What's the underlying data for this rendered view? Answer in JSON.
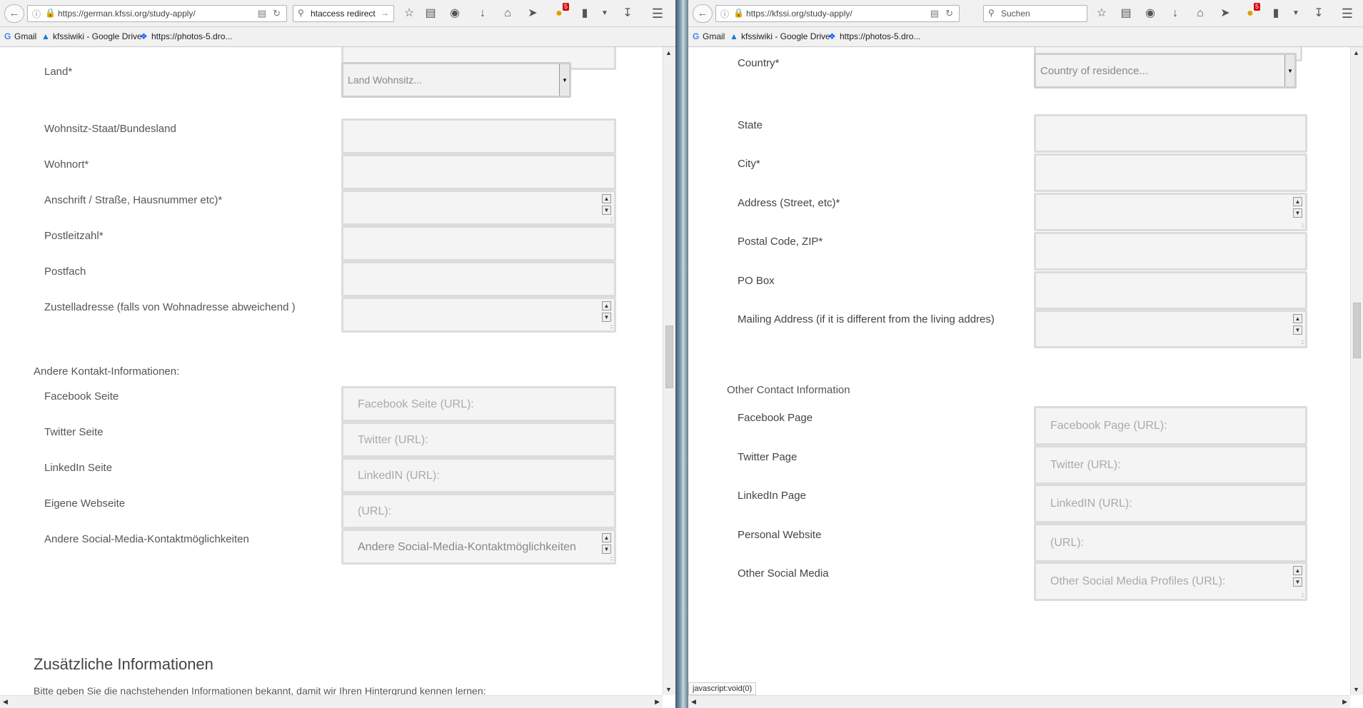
{
  "left": {
    "browser": {
      "url": "https://german.kfssi.org/study-apply/",
      "search_value": "htaccess redirect",
      "badge_count": "5",
      "bookmarks": [
        {
          "icon": "google-icon",
          "label": "Gmail"
        },
        {
          "icon": "drive-icon",
          "label": "kfssiwiki - Google Drive"
        },
        {
          "icon": "dropbox-icon",
          "label": "https://photos-5.dro..."
        }
      ]
    },
    "form": {
      "country_label": "Land*",
      "country_value": "Land Wohnsitz...",
      "state_label": "Wohnsitz-Staat/Bundesland",
      "city_label": "Wohnort*",
      "address_label": "Anschrift / Straße, Hausnummer etc)*",
      "zip_label": "Postleitzahl*",
      "pobox_label": "Postfach",
      "mailing_label": "Zustelladresse (falls von Wohnadresse abweichend )",
      "contact_heading": "Andere Kontakt-Informationen:",
      "facebook_label": "Facebook Seite",
      "facebook_placeholder": "Facebook Seite (URL):",
      "twitter_label": "Twitter Seite",
      "twitter_placeholder": "Twitter (URL):",
      "linkedin_label": "LinkedIn Seite",
      "linkedin_placeholder": "LinkedIN (URL):",
      "website_label": "Eigene Webseite",
      "website_placeholder": "(URL):",
      "social_label": "Andere Social-Media-Kontaktmöglichkeiten",
      "social_placeholder": "Andere Social-Media-Kontaktmöglichkeiten",
      "additional_heading": "Zusätzliche Informationen",
      "additional_intro": "Bitte geben Sie die nachstehenden Informationen bekannt, damit wir Ihren Hintergrund kennen lernen:"
    }
  },
  "right": {
    "browser": {
      "url": "https://kfssi.org/study-apply/",
      "search_placeholder": "Suchen",
      "badge_count": "5",
      "bookmarks": [
        {
          "icon": "google-icon",
          "label": "Gmail"
        },
        {
          "icon": "drive-icon",
          "label": "kfssiwiki - Google Drive"
        },
        {
          "icon": "dropbox-icon",
          "label": "https://photos-5.dro..."
        }
      ],
      "status_text": "javascript:void(0)"
    },
    "form": {
      "country_label": "Country*",
      "country_value": "Country of residence...",
      "state_label": "State",
      "city_label": "City*",
      "address_label": "Address (Street, etc)*",
      "zip_label": "Postal Code, ZIP*",
      "pobox_label": "PO Box",
      "mailing_label": "Mailing Address (if it is different from the living addres)",
      "contact_heading": "Other Contact Information",
      "facebook_label": "Facebook Page",
      "facebook_placeholder": "Facebook Page (URL):",
      "twitter_label": "Twitter Page",
      "twitter_placeholder": "Twitter (URL):",
      "linkedin_label": "LinkedIn Page",
      "linkedin_placeholder": "LinkedIN (URL):",
      "website_label": "Personal Website",
      "website_placeholder": "(URL):",
      "social_label": "Other Social Media",
      "social_placeholder": "Other Social Media Profiles (URL):"
    }
  }
}
